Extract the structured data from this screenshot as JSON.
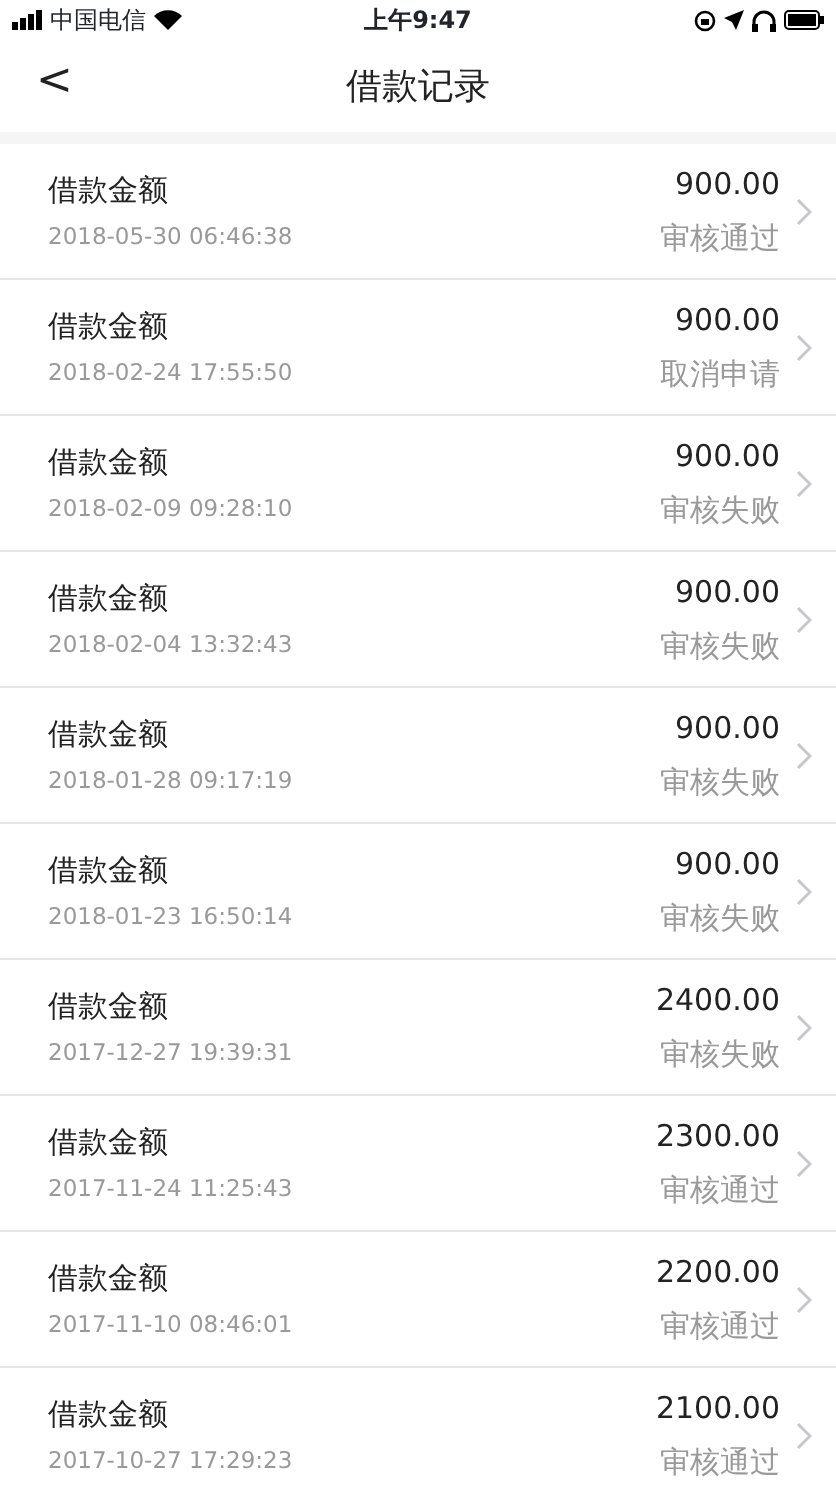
{
  "status_bar": {
    "carrier": "中国电信",
    "time": "上午9:47"
  },
  "nav": {
    "back": "<",
    "title": "借款记录"
  },
  "records": [
    {
      "label": "借款金额",
      "datetime": "2018-05-30 06:46:38",
      "amount": "900.00",
      "status": "审核通过"
    },
    {
      "label": "借款金额",
      "datetime": "2018-02-24 17:55:50",
      "amount": "900.00",
      "status": "取消申请"
    },
    {
      "label": "借款金额",
      "datetime": "2018-02-09 09:28:10",
      "amount": "900.00",
      "status": "审核失败"
    },
    {
      "label": "借款金额",
      "datetime": "2018-02-04 13:32:43",
      "amount": "900.00",
      "status": "审核失败"
    },
    {
      "label": "借款金额",
      "datetime": "2018-01-28 09:17:19",
      "amount": "900.00",
      "status": "审核失败"
    },
    {
      "label": "借款金额",
      "datetime": "2018-01-23 16:50:14",
      "amount": "900.00",
      "status": "审核失败"
    },
    {
      "label": "借款金额",
      "datetime": "2017-12-27 19:39:31",
      "amount": "2400.00",
      "status": "审核失败"
    },
    {
      "label": "借款金额",
      "datetime": "2017-11-24 11:25:43",
      "amount": "2300.00",
      "status": "审核通过"
    },
    {
      "label": "借款金额",
      "datetime": "2017-11-10 08:46:01",
      "amount": "2200.00",
      "status": "审核通过"
    },
    {
      "label": "借款金额",
      "datetime": "2017-10-27 17:29:23",
      "amount": "2100.00",
      "status": "审核通过"
    }
  ]
}
